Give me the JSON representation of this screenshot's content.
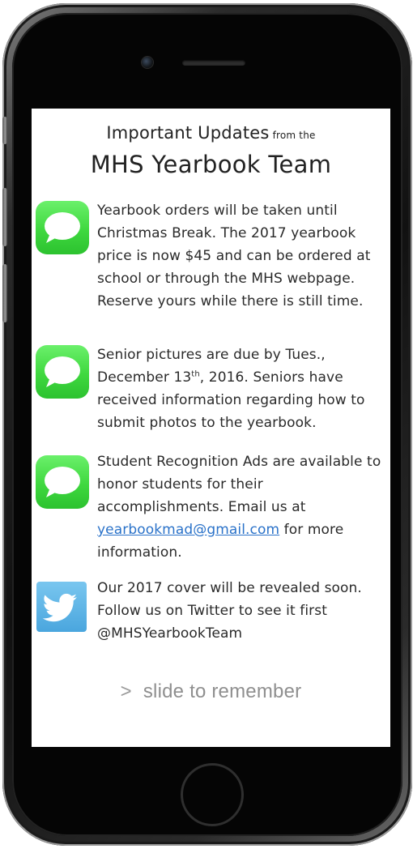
{
  "header": {
    "title_main": "Important Updates",
    "title_small": "from the",
    "team": "MHS Yearbook Team"
  },
  "updates": [
    {
      "icon": "messages-icon",
      "text": "Yearbook orders will be taken until Christmas Break. The 2017 yearbook price is now $45 and can be ordered at school or through the MHS webpage. Reserve yours while there is still time."
    },
    {
      "icon": "messages-icon",
      "text_a": "Senior pictures are due by Tues., December 13",
      "text_sup": "th",
      "text_b": ", 2016. Seniors have received information regarding how to submit photos to the yearbook."
    },
    {
      "icon": "messages-icon",
      "text_a": "Student Recognition Ads are available to honor students for their accomplishments. Email us at ",
      "email": "yearbookmad@gmail.com",
      "text_b": " for more information."
    },
    {
      "icon": "twitter-icon",
      "text": "Our 2017 cover will be revealed soon. Follow us on Twitter to see it first @MHSYearbookTeam"
    }
  ],
  "unlock": {
    "chevron": ">",
    "label": "slide to remember"
  },
  "colors": {
    "messages_green": "#3fd83f",
    "twitter_blue": "#4aa6de",
    "link_blue": "#2a72c9",
    "slide_gray": "#8f8f8f"
  }
}
